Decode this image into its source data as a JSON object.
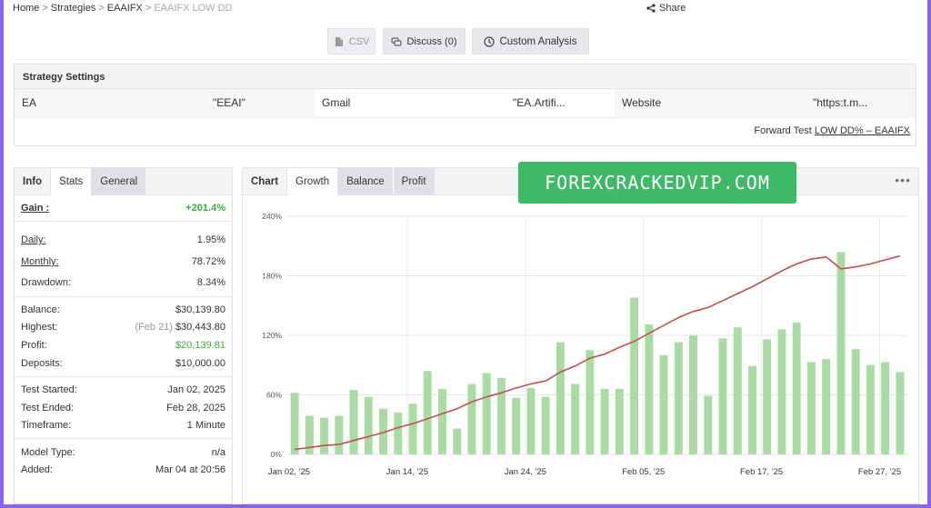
{
  "breadcrumb": {
    "home": "Home",
    "strategies": "Strategies",
    "parent": "EAAIFX",
    "current": "EAAIFX LOW DD",
    "sep": ">"
  },
  "share": "Share",
  "toolbar": {
    "csv": "CSV",
    "discuss": "Discuss (0)",
    "custom": "Custom Analysis"
  },
  "settings": {
    "title": "Strategy Settings",
    "cells": [
      "EA",
      "\"EEAI\"",
      "Gmail",
      "\"EA.Artifi...",
      "Website",
      "\"https:t.m..."
    ],
    "forward_prefix": "Forward Test",
    "forward_link": "LOW DD% – EAAIFX"
  },
  "stats": {
    "tabs": [
      "Info",
      "Stats",
      "General"
    ],
    "gain_label": "Gain :",
    "gain_value": "+201.4%",
    "daily_label": "Daily:",
    "daily_value": "1.95%",
    "monthly_label": "Monthly:",
    "monthly_value": "78.72%",
    "drawdown_label": "Drawdown:",
    "drawdown_value": "8.34%",
    "balance_label": "Balance:",
    "balance_value": "$30,139.80",
    "highest_label": "Highest:",
    "highest_note": "(Feb 21)",
    "highest_value": "$30,443.80",
    "profit_label": "Profit:",
    "profit_value": "$20,139.81",
    "deposits_label": "Deposits:",
    "deposits_value": "$10,000.00",
    "started_label": "Test Started:",
    "started_value": "Jan 02, 2025",
    "ended_label": "Test Ended:",
    "ended_value": "Feb 28, 2025",
    "timeframe_label": "Timeframe:",
    "timeframe_value": "1 Minute",
    "model_label": "Model Type:",
    "model_value": "n/a",
    "added_label": "Added:",
    "added_value": "Mar 04 at 20:56"
  },
  "chart": {
    "tabs": [
      "Chart",
      "Growth",
      "Balance",
      "Profit"
    ],
    "menu": "•••"
  },
  "watermark": "FOREXCRACKEDVIP.COM",
  "colors": {
    "bars": "#a9dba4",
    "line": "#c0504d",
    "green_text": "#3aab3f",
    "watermark_bg": "#3fb868"
  },
  "chart_data": {
    "type": "bar",
    "y_ticks": [
      "0%",
      "60%",
      "120%",
      "180%",
      "240%"
    ],
    "x_ticks": [
      "Jan 02, '25",
      "Jan 14, '25",
      "Jan 24, '25",
      "Feb 05, '25",
      "Feb 17, '25",
      "Feb 27, '25"
    ],
    "ylim": [
      0,
      240
    ],
    "grid": true,
    "bars": [
      62,
      39,
      37,
      39,
      65,
      58,
      46,
      42,
      51,
      84,
      66,
      26,
      71,
      82,
      77,
      57,
      67,
      58,
      113,
      71,
      105,
      66,
      66,
      158,
      131,
      100,
      113,
      120,
      59,
      117,
      128,
      89,
      116,
      126,
      133,
      93,
      96,
      204,
      106,
      90,
      93,
      83
    ],
    "line": [
      5,
      7,
      9,
      10,
      14,
      18,
      22,
      27,
      31,
      36,
      41,
      46,
      53,
      58,
      62,
      67,
      71,
      74,
      83,
      89,
      97,
      101,
      108,
      114,
      122,
      130,
      138,
      144,
      148,
      155,
      162,
      169,
      177,
      185,
      192,
      197,
      199,
      187,
      189,
      192,
      196,
      200
    ]
  }
}
